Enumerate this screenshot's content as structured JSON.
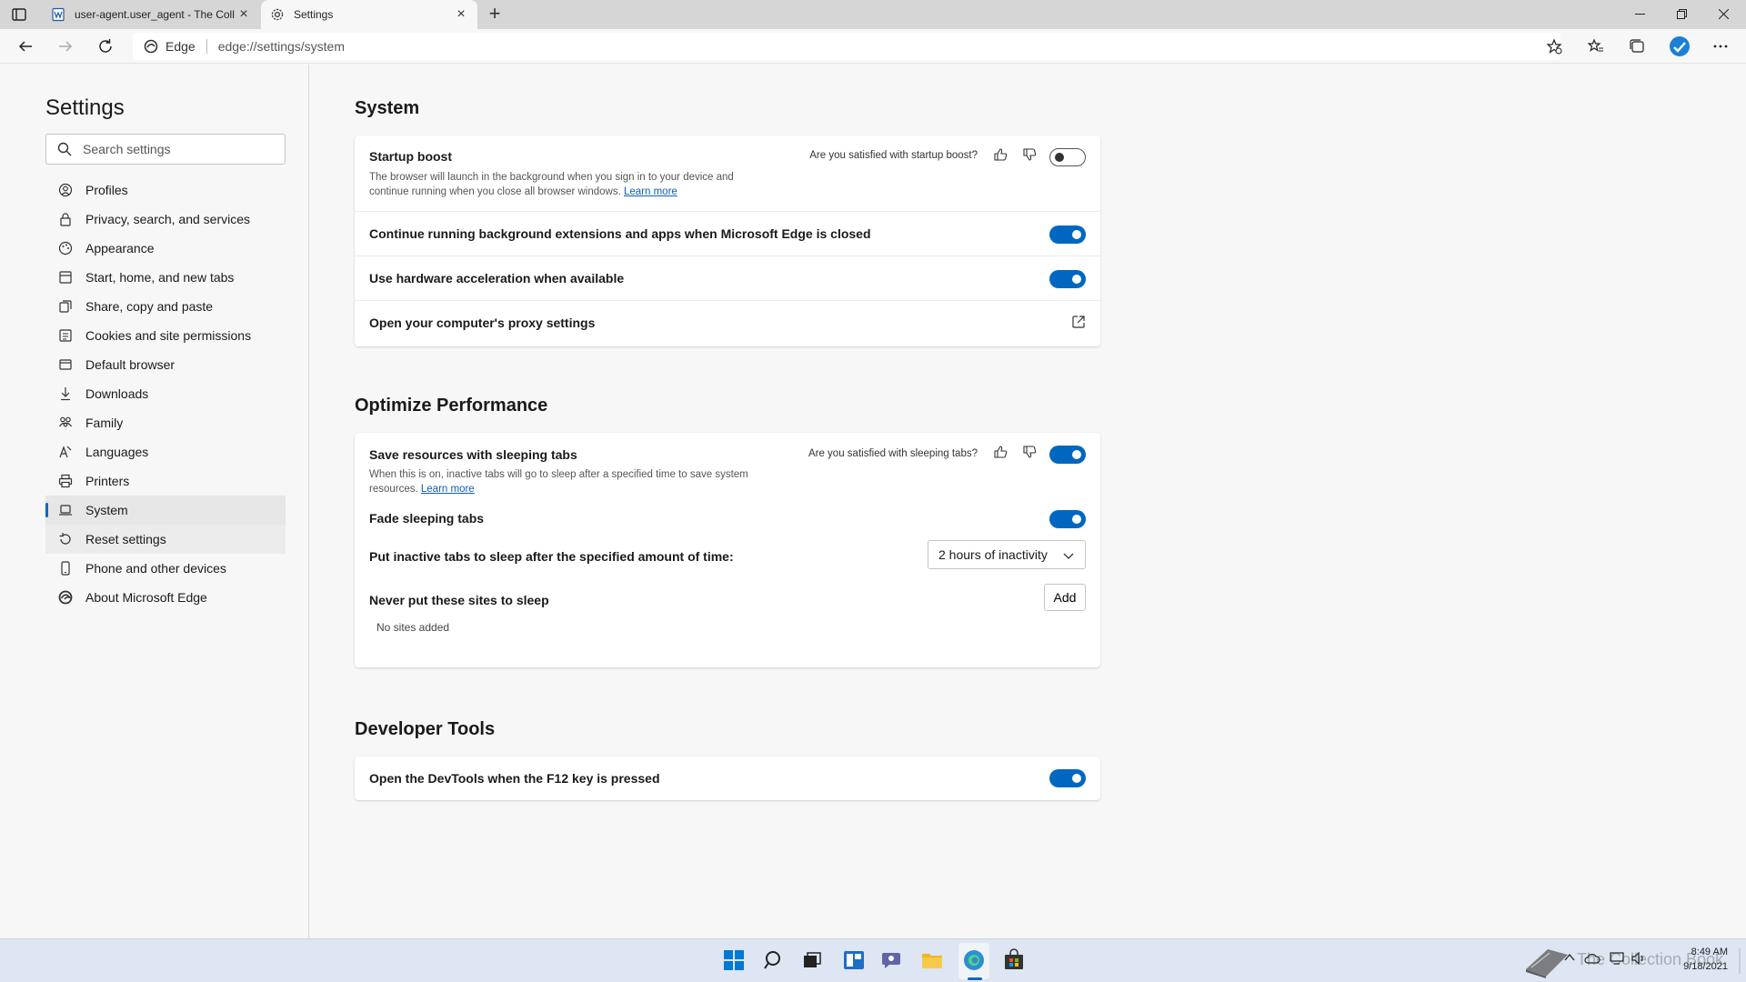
{
  "browser": {
    "tabs": [
      {
        "label": "user-agent.user_agent - The Coll",
        "active": false
      },
      {
        "label": "Settings",
        "active": true
      }
    ],
    "address": {
      "site": "Edge",
      "url": "edge://settings/system"
    }
  },
  "sidebar": {
    "title": "Settings",
    "search_placeholder": "Search settings",
    "items": [
      {
        "label": "Profiles",
        "icon": "profile-icon"
      },
      {
        "label": "Privacy, search, and services",
        "icon": "lock-icon"
      },
      {
        "label": "Appearance",
        "icon": "appearance-icon"
      },
      {
        "label": "Start, home, and new tabs",
        "icon": "home-icon"
      },
      {
        "label": "Share, copy and paste",
        "icon": "share-icon"
      },
      {
        "label": "Cookies and site permissions",
        "icon": "cookies-icon"
      },
      {
        "label": "Default browser",
        "icon": "browser-icon"
      },
      {
        "label": "Downloads",
        "icon": "download-icon"
      },
      {
        "label": "Family",
        "icon": "family-icon"
      },
      {
        "label": "Languages",
        "icon": "language-icon"
      },
      {
        "label": "Printers",
        "icon": "printer-icon"
      },
      {
        "label": "System",
        "icon": "laptop-icon",
        "selected": true
      },
      {
        "label": "Reset settings",
        "icon": "reset-icon"
      },
      {
        "label": "Phone and other devices",
        "icon": "phone-icon"
      },
      {
        "label": "About Microsoft Edge",
        "icon": "edge-icon"
      }
    ]
  },
  "system": {
    "title": "System",
    "startup_boost": {
      "title": "Startup boost",
      "desc": "The browser will launch in the background when you sign in to your device and continue running when you close all browser windows.",
      "link": "Learn more",
      "feedback": "Are you satisfied with startup boost?",
      "enabled": false
    },
    "background_ext": {
      "title": "Continue running background extensions and apps when Microsoft Edge is closed",
      "enabled": true
    },
    "hw_accel": {
      "title": "Use hardware acceleration when available",
      "enabled": true
    },
    "proxy": {
      "title": "Open your computer's proxy settings"
    }
  },
  "performance": {
    "title": "Optimize Performance",
    "sleeping_tabs": {
      "title": "Save resources with sleeping tabs",
      "desc": "When this is on, inactive tabs will go to sleep after a specified time to save system resources.",
      "link": "Learn more",
      "feedback": "Are you satisfied with sleeping tabs?",
      "enabled": true
    },
    "fade_tabs": {
      "title": "Fade sleeping tabs",
      "enabled": true
    },
    "sleep_after": {
      "title": "Put inactive tabs to sleep after the specified amount of time:",
      "value": "2 hours of inactivity"
    },
    "never_sleep": {
      "title": "Never put these sites to sleep",
      "add_label": "Add",
      "empty": "No sites added"
    }
  },
  "devtools": {
    "title": "Developer Tools",
    "f12": {
      "title": "Open the DevTools when the F12 key is pressed",
      "enabled": true
    }
  },
  "taskbar": {
    "clock_time": "8:49 AM",
    "clock_date": "9/18/2021",
    "watermark": "The Collection Book"
  },
  "colors": {
    "accent": "#0067c0",
    "taskbar": "#dde6f2"
  }
}
